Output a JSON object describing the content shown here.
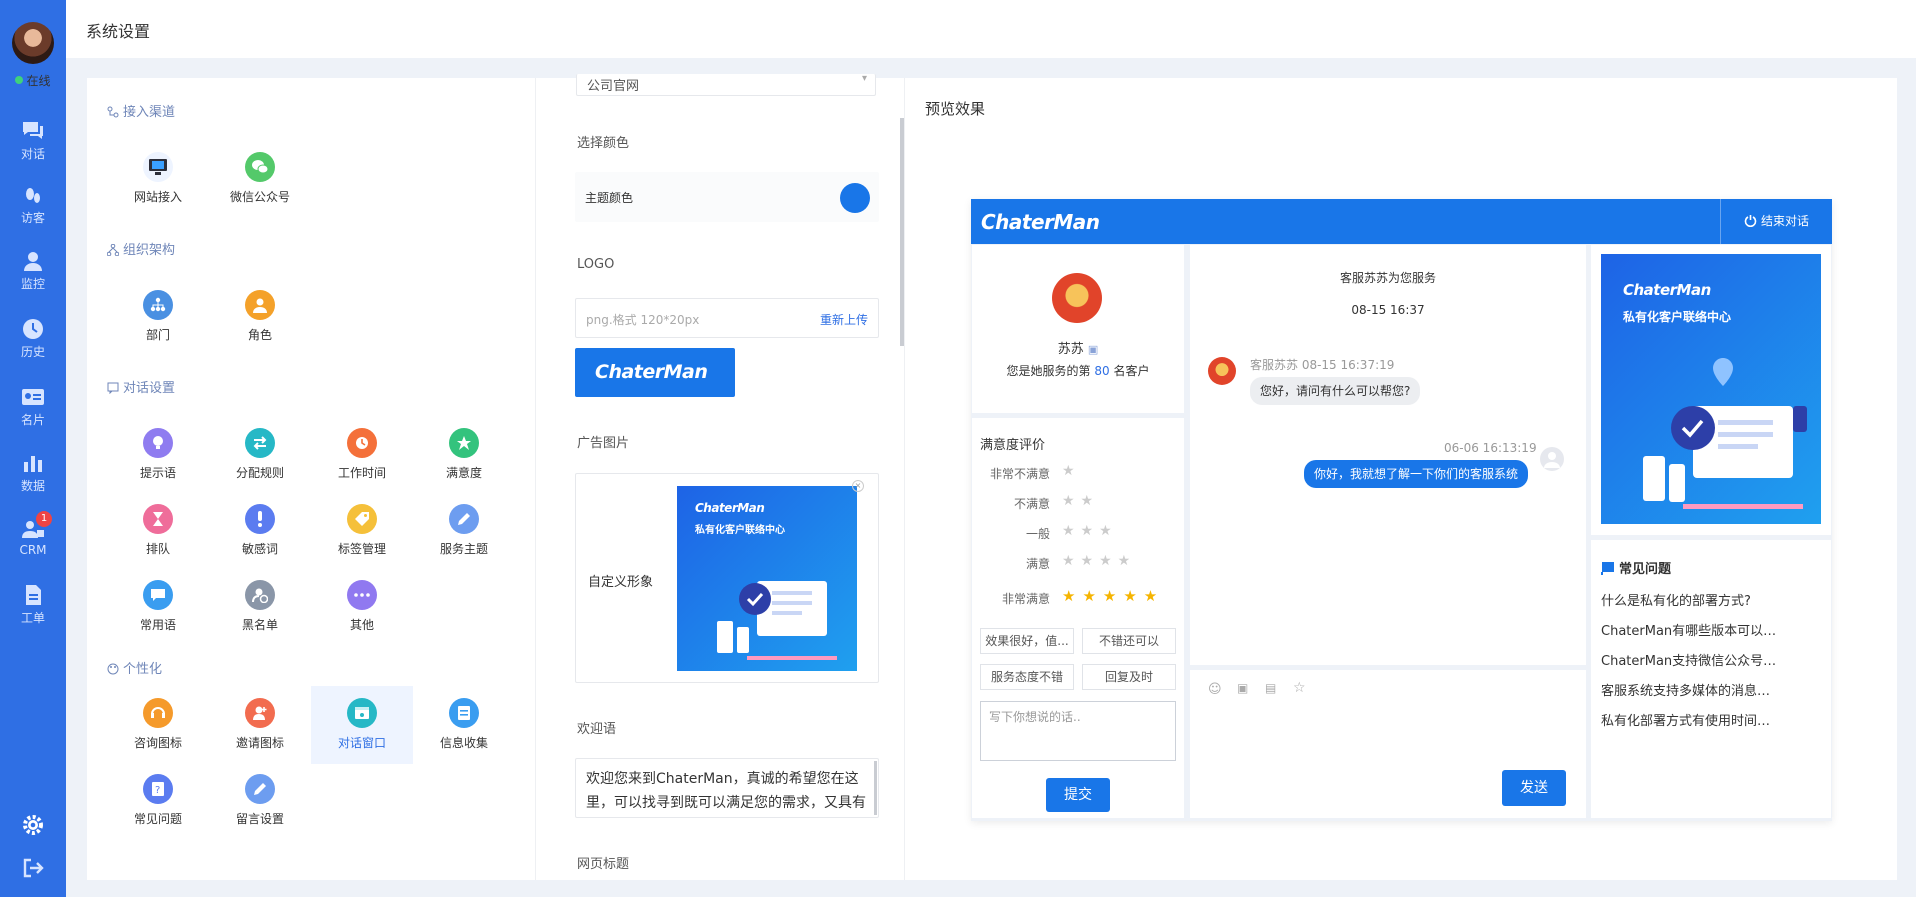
{
  "nav": {
    "online": "在线",
    "items": [
      "对话",
      "访客",
      "监控",
      "历史",
      "名片",
      "数据",
      "CRM",
      "工单"
    ],
    "crm_badge": "1"
  },
  "header": {
    "title": "系统设置"
  },
  "settings": {
    "sections": [
      {
        "title": "接入渠道",
        "items": [
          "网站接入",
          "微信公众号"
        ]
      },
      {
        "title": "组织架构",
        "items": [
          "部门",
          "角色"
        ]
      },
      {
        "title": "对话设置",
        "items": [
          "提示语",
          "分配规则",
          "工作时间",
          "满意度",
          "排队",
          "敏感词",
          "标签管理",
          "服务主题",
          "常用语",
          "黑名单",
          "其他"
        ]
      },
      {
        "title": "个性化",
        "items": [
          "咨询图标",
          "邀请图标",
          "对话窗口",
          "信息收集",
          "常见问题",
          "留言设置"
        ]
      }
    ],
    "selected": "对话窗口"
  },
  "config": {
    "top_select": "公司官网",
    "color_label": "选择颜色",
    "theme_color_label": "主题颜色",
    "theme_color": "#1976e8",
    "logo_label": "LOGO",
    "logo_placeholder": "png.格式 120*20px",
    "reupload": "重新上传",
    "logo_text": "ChaterMan",
    "ad_label": "广告图片",
    "custom_image": "自定义形象",
    "welcome_label": "欢迎语",
    "welcome_text": "欢迎您来到ChaterMan，真诚的希望您在这里，可以找寻到既可以满足您的需求，又具有超高性价比的产品。",
    "page_title_label": "网页标题"
  },
  "preview": {
    "title": "预览效果",
    "logo": "ChaterMan",
    "end_chat": "结束对话",
    "agent_name": "苏苏",
    "served_prefix": "您是她服务的第",
    "served_count": "80",
    "served_suffix": "名客户",
    "service_notice": "客服苏苏为您服务",
    "notice_time": "08-15 16:37",
    "agent_msg_meta": "客服苏苏 08-15 16:37:19",
    "agent_msg": "您好，请问有什么可以帮您?",
    "user_msg_time": "06-06 16:13:19",
    "user_msg": "你好，我就想了解一下你们的客服系统",
    "rating_title": "满意度评价",
    "ratings": [
      {
        "label": "非常不满意",
        "stars": 1
      },
      {
        "label": "不满意",
        "stars": 2
      },
      {
        "label": "一般",
        "stars": 3
      },
      {
        "label": "满意",
        "stars": 4
      },
      {
        "label": "非常满意",
        "stars": 5
      }
    ],
    "tags": [
      "效果很好，值...",
      "不错还可以",
      "服务态度不错",
      "回复及时"
    ],
    "comment_placeholder": "写下你想说的话..",
    "submit": "提交",
    "send": "发送",
    "ad_logo": "ChaterMan",
    "ad_subtitle": "私有化客户联络中心",
    "faq_title": "常见问题",
    "faq": [
      "什么是私有化的部署方式?",
      "ChaterMan有哪些版本可以选择?",
      "ChaterMan支持微信公众号接入...",
      "客服系统支持多媒体的消息发送...",
      "私有化部署方式有使用时间和坐..."
    ]
  }
}
